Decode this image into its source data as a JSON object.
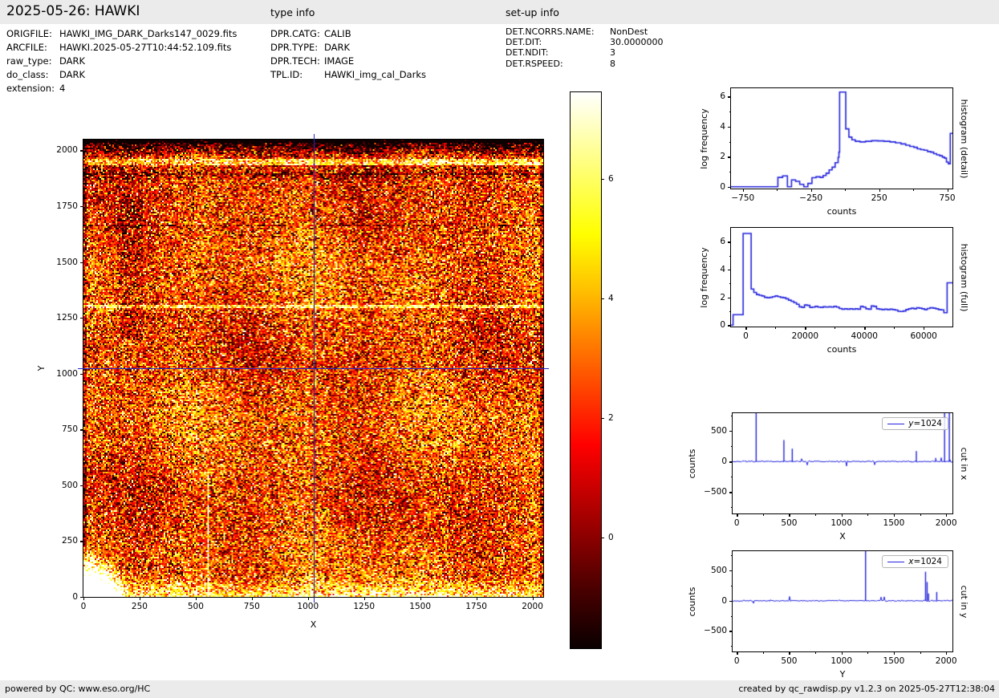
{
  "header": {
    "title": "2025-05-26: HAWKI",
    "type_info_label": "type info",
    "setup_info_label": "set-up info"
  },
  "file_info": {
    "rows": [
      {
        "label": "ORIGFILE:",
        "value": "HAWKI_IMG_DARK_Darks147_0029.fits"
      },
      {
        "label": "ARCFILE:",
        "value": "HAWKI.2025-05-27T10:44:52.109.fits"
      },
      {
        "label": "raw_type:",
        "value": "DARK"
      },
      {
        "label": "do_class:",
        "value": "DARK"
      },
      {
        "label": "extension:",
        "value": "4"
      }
    ]
  },
  "type_info": {
    "rows": [
      {
        "label": "DPR.CATG:",
        "value": "CALIB"
      },
      {
        "label": "DPR.TYPE:",
        "value": "DARK"
      },
      {
        "label": "DPR.TECH:",
        "value": "IMAGE"
      },
      {
        "label": "TPL.ID:",
        "value": "HAWKI_img_cal_Darks"
      }
    ]
  },
  "setup_info": {
    "rows": [
      {
        "label": "DET.NCORRS.NAME:",
        "value": "NonDest"
      },
      {
        "label": "DET.DIT:",
        "value": "30.0000000"
      },
      {
        "label": "DET.NDIT:",
        "value": "3"
      },
      {
        "label": "DET.RSPEED:",
        "value": "8"
      }
    ]
  },
  "footer": {
    "left": "powered by QC: www.eso.org/HC",
    "right": "created by qc_rawdisp.py v1.2.3 on 2025-05-27T12:38:04"
  },
  "colors": {
    "line": "#2222dd",
    "crosshair": "#2328cf",
    "header_bg": "#ebebeb",
    "footer_bg": "#ebebeb",
    "colormap": "hot"
  },
  "chart_data": [
    {
      "id": "main-image",
      "type": "heatmap",
      "title": "",
      "xlabel": "X",
      "ylabel": "Y",
      "xlim": [
        0,
        2048
      ],
      "ylim": [
        0,
        2048
      ],
      "xticks": [
        0,
        250,
        500,
        750,
        1000,
        1250,
        1500,
        1750,
        2000
      ],
      "xticklabels": [
        "0",
        "250",
        "500",
        "750",
        "1000",
        "1250",
        "1500",
        "1750",
        "2000"
      ],
      "yticks": [
        0,
        250,
        500,
        750,
        1000,
        1250,
        1500,
        1750,
        2000
      ],
      "yticklabels": [
        "0",
        "250",
        "500",
        "750",
        "1000",
        "1250",
        "1500",
        "1750",
        "2000"
      ],
      "colormap": "hot",
      "seed": 42,
      "crosshair": {
        "x": 1024,
        "y": 1024
      },
      "colorbar": {
        "range": [
          -1.85,
          7.45
        ],
        "ticks": [
          0,
          2,
          4,
          6
        ],
        "ticklabels": [
          "0",
          "2",
          "4",
          "6"
        ]
      },
      "description": "Raw HAWKI dark frame: speckled hot-colormap noise, bright saturated blob in bottom-left corner, bright band near bottom edge, dark band with bright streak near top edge, faint bright row near y=1300, blue crosshair cut lines at x=1024 and y=1024"
    },
    {
      "id": "hist-detail",
      "type": "step",
      "xlabel": "counts",
      "ylabel": "log frequency",
      "right_label": "histogram (detail)",
      "xlim": [
        -837,
        788
      ],
      "ylim": [
        -0.12,
        6.55
      ],
      "xticks": [
        -750,
        -250,
        250,
        750
      ],
      "xticklabels": [
        "−750",
        "−250",
        "250",
        "750"
      ],
      "xminor": [
        -500,
        0,
        500
      ],
      "yticks": [
        0,
        2,
        4,
        6
      ],
      "yticklabels": [
        "0",
        "2",
        "4",
        "6"
      ],
      "yminor": [
        1,
        3,
        5
      ],
      "steps": [
        [
          -837,
          0
        ],
        [
          -493,
          0.62
        ],
        [
          -458,
          0.72
        ],
        [
          -423,
          0
        ],
        [
          -393,
          0.45
        ],
        [
          -363,
          0.36
        ],
        [
          -333,
          0.16
        ],
        [
          -303,
          0
        ],
        [
          -273,
          0.22
        ],
        [
          -243,
          0.6
        ],
        [
          -213,
          0.66
        ],
        [
          -183,
          0.62
        ],
        [
          -161,
          0.75
        ],
        [
          -139,
          0.9
        ],
        [
          -117,
          1.12
        ],
        [
          -95,
          1.3
        ],
        [
          -73,
          1.6
        ],
        [
          -51,
          1.95
        ],
        [
          -45,
          2.3
        ],
        [
          -40,
          6.3
        ],
        [
          5,
          3.85
        ],
        [
          28,
          3.3
        ],
        [
          50,
          3.12
        ],
        [
          75,
          3.02
        ],
        [
          110,
          2.98
        ],
        [
          150,
          3.02
        ],
        [
          195,
          3.06
        ],
        [
          240,
          3.05
        ],
        [
          285,
          3.02
        ],
        [
          330,
          2.98
        ],
        [
          370,
          2.92
        ],
        [
          410,
          2.85
        ],
        [
          445,
          2.76
        ],
        [
          475,
          2.68
        ],
        [
          505,
          2.62
        ],
        [
          530,
          2.52
        ],
        [
          555,
          2.47
        ],
        [
          580,
          2.43
        ],
        [
          605,
          2.34
        ],
        [
          628,
          2.3
        ],
        [
          650,
          2.2
        ],
        [
          672,
          2.12
        ],
        [
          694,
          2.06
        ],
        [
          714,
          1.97
        ],
        [
          730,
          1.9
        ],
        [
          744,
          1.64
        ],
        [
          758,
          1.53
        ],
        [
          772,
          3.55
        ],
        [
          788,
          3.55
        ]
      ]
    },
    {
      "id": "hist-full",
      "type": "step",
      "xlabel": "counts",
      "ylabel": "log frequency",
      "right_label": "histogram (full)",
      "xlim": [
        -5000,
        69700
      ],
      "ylim": [
        -0.1,
        7.0
      ],
      "xticks": [
        0,
        20000,
        40000,
        60000
      ],
      "xticklabels": [
        "0",
        "20000",
        "40000",
        "60000"
      ],
      "xminor": [
        10000,
        30000,
        50000
      ],
      "yticks": [
        0,
        2,
        4,
        6
      ],
      "yticklabels": [
        "0",
        "2",
        "4",
        "6"
      ],
      "yminor": [
        1,
        3,
        5
      ],
      "steps": [
        [
          -5000,
          0
        ],
        [
          -4300,
          0.75
        ],
        [
          -900,
          6.6
        ],
        [
          1800,
          2.6
        ],
        [
          2700,
          2.35
        ],
        [
          3600,
          2.2
        ],
        [
          4500,
          2.15
        ],
        [
          5400,
          2.1
        ],
        [
          6300,
          2.0
        ],
        [
          7200,
          1.97
        ],
        [
          8100,
          2.0
        ],
        [
          9000,
          2.05
        ],
        [
          9900,
          2.1
        ],
        [
          10800,
          2.05
        ],
        [
          11700,
          2.0
        ],
        [
          12600,
          1.97
        ],
        [
          13500,
          1.9
        ],
        [
          14400,
          1.8
        ],
        [
          15300,
          1.72
        ],
        [
          16200,
          1.62
        ],
        [
          17100,
          1.5
        ],
        [
          18000,
          1.32
        ],
        [
          18900,
          1.28
        ],
        [
          19800,
          1.45
        ],
        [
          20700,
          1.42
        ],
        [
          21600,
          1.28
        ],
        [
          22500,
          1.3
        ],
        [
          23400,
          1.35
        ],
        [
          24300,
          1.3
        ],
        [
          25200,
          1.28
        ],
        [
          26100,
          1.32
        ],
        [
          27000,
          1.3
        ],
        [
          27900,
          1.32
        ],
        [
          28800,
          1.3
        ],
        [
          29700,
          1.35
        ],
        [
          30600,
          1.3
        ],
        [
          31500,
          1.2
        ],
        [
          32400,
          1.15
        ],
        [
          33300,
          1.18
        ],
        [
          34200,
          1.15
        ],
        [
          35100,
          1.18
        ],
        [
          36000,
          1.15
        ],
        [
          36900,
          1.18
        ],
        [
          37800,
          1.15
        ],
        [
          38700,
          1.35
        ],
        [
          39600,
          1.3
        ],
        [
          40500,
          1.18
        ],
        [
          41400,
          1.15
        ],
        [
          42300,
          1.38
        ],
        [
          43200,
          1.35
        ],
        [
          44100,
          1.18
        ],
        [
          45000,
          1.15
        ],
        [
          45900,
          1.12
        ],
        [
          46800,
          1.15
        ],
        [
          47700,
          1.12
        ],
        [
          48600,
          1.15
        ],
        [
          49500,
          1.12
        ],
        [
          50400,
          1.08
        ],
        [
          51300,
          1.0
        ],
        [
          52200,
          0.98
        ],
        [
          53100,
          1.02
        ],
        [
          54000,
          1.12
        ],
        [
          54900,
          1.18
        ],
        [
          55800,
          1.22
        ],
        [
          56700,
          1.18
        ],
        [
          57600,
          1.25
        ],
        [
          58500,
          1.22
        ],
        [
          59400,
          1.18
        ],
        [
          60300,
          1.12
        ],
        [
          61200,
          1.2
        ],
        [
          62100,
          1.25
        ],
        [
          63200,
          1.22
        ],
        [
          64100,
          1.18
        ],
        [
          65000,
          1.12
        ],
        [
          65900,
          1.1
        ],
        [
          66800,
          0.9
        ],
        [
          67900,
          3.05
        ],
        [
          69700,
          3.05
        ]
      ]
    },
    {
      "id": "cut-x",
      "type": "cut",
      "xlabel": "X",
      "ylabel": "counts",
      "right_label": "cut in x",
      "legend_label": "y=1024",
      "xlim": [
        -40,
        2060
      ],
      "ylim": [
        -850,
        790
      ],
      "xticks": [
        0,
        500,
        1000,
        1500,
        2000
      ],
      "xticklabels": [
        "0",
        "500",
        "1000",
        "1500",
        "2000"
      ],
      "xminor": [
        250,
        750,
        1250,
        1750
      ],
      "yticks": [
        -500,
        0,
        500
      ],
      "yticklabels": [
        "−500",
        "0",
        "500"
      ],
      "yminor": [
        -750,
        -250,
        250,
        750
      ],
      "noise_sigma": 9,
      "seed": 7,
      "spikes": [
        [
          185,
          900
        ],
        [
          450,
          350
        ],
        [
          530,
          210
        ],
        [
          1715,
          170
        ],
        [
          1900,
          60
        ],
        [
          1985,
          900
        ],
        [
          2030,
          900
        ]
      ]
    },
    {
      "id": "cut-y",
      "type": "cut",
      "xlabel": "Y",
      "ylabel": "counts",
      "right_label": "cut in y",
      "legend_label": "x=1024",
      "xlim": [
        -40,
        2060
      ],
      "ylim": [
        -840,
        820
      ],
      "xticks": [
        0,
        500,
        1000,
        1500,
        2000
      ],
      "xticklabels": [
        "0",
        "500",
        "1000",
        "1500",
        "2000"
      ],
      "xminor": [
        250,
        750,
        1250,
        1750
      ],
      "yticks": [
        -500,
        0,
        500
      ],
      "yticklabels": [
        "−500",
        "0",
        "500"
      ],
      "yminor": [
        -750,
        -250,
        250,
        750
      ],
      "noise_sigma": 9,
      "seed": 13,
      "spikes": [
        [
          1230,
          900
        ],
        [
          1803,
          480
        ],
        [
          1818,
          310
        ],
        [
          1832,
          120
        ],
        [
          1910,
          145
        ]
      ]
    }
  ]
}
